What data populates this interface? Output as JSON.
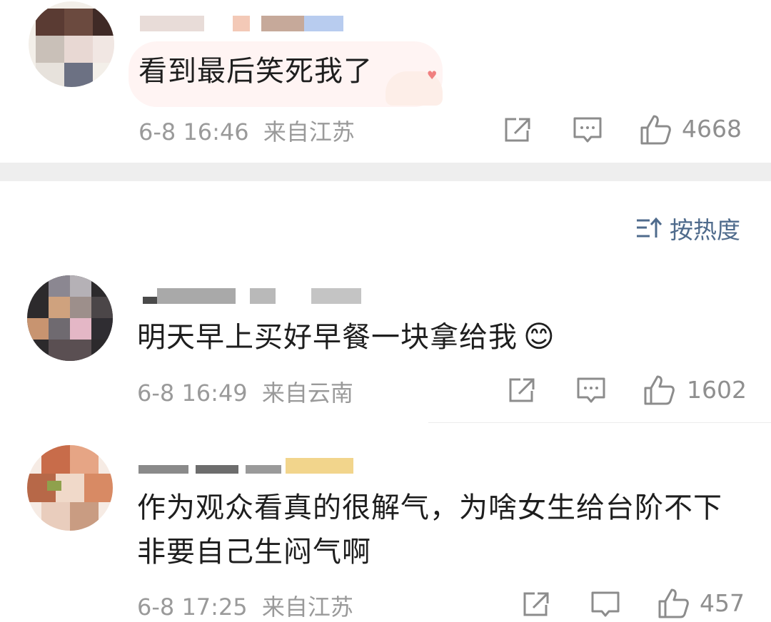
{
  "comments": [
    {
      "text": "看到最后笑死我了",
      "date": "6-8 16:46",
      "location": "来自江苏",
      "likes": "4668",
      "share_icon": "share-icon",
      "comment_icon": "comment-icon",
      "like_icon": "thumbs-up-icon"
    },
    {
      "text": "明天早上买好早餐一块拿给我",
      "emoji": "😊",
      "date": "6-8 16:49",
      "location": "来自云南",
      "likes": "1602",
      "share_icon": "share-icon",
      "comment_icon": "comment-icon",
      "like_icon": "thumbs-up-icon"
    },
    {
      "text_line1": "作为观众看真的很解气，为啥女生给台阶不下",
      "text_line2": "非要自己生闷气啊",
      "date": "6-8 17:25",
      "location": "来自江苏",
      "likes": "457",
      "share_icon": "share-icon",
      "comment_icon": "comment-icon",
      "like_icon": "thumbs-up-icon"
    }
  ],
  "sort": {
    "label": "按热度",
    "icon": "sort-icon"
  },
  "colors": {
    "meta_gray": "#9a9a9a",
    "sort_blue": "#4f6b8c",
    "divider": "#eeeeee"
  }
}
